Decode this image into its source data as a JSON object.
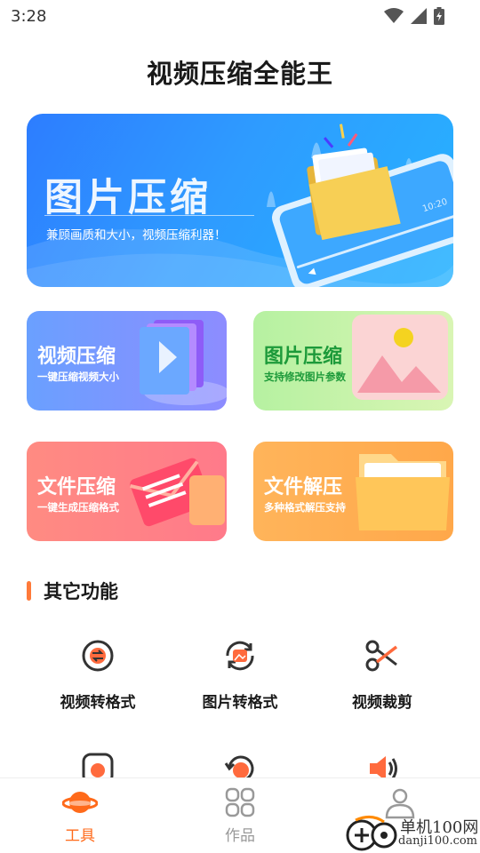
{
  "status": {
    "time": "3:28"
  },
  "app": {
    "title": "视频压缩全能王"
  },
  "banner": {
    "title": "图片压缩",
    "subtitle": "兼顾画质和大小，视频压缩利器！",
    "phone_time": "10:20"
  },
  "cards": [
    {
      "title": "视频压缩",
      "subtitle": "一键压缩视频大小"
    },
    {
      "title": "图片压缩",
      "subtitle": "支持修改图片参数"
    },
    {
      "title": "文件压缩",
      "subtitle": "一键生成压缩格式"
    },
    {
      "title": "文件解压",
      "subtitle": "多种格式解压支持"
    }
  ],
  "section": {
    "title": "其它功能"
  },
  "tools": [
    {
      "label": "视频转格式",
      "icon": "video-convert-icon"
    },
    {
      "label": "图片转格式",
      "icon": "image-convert-icon"
    },
    {
      "label": "视频裁剪",
      "icon": "scissors-icon"
    },
    {
      "label": "",
      "icon": "video-extract-icon"
    },
    {
      "label": "",
      "icon": "rotate-icon"
    },
    {
      "label": "",
      "icon": "audio-icon"
    }
  ],
  "tabs": [
    {
      "label": "工具",
      "icon": "planet-icon",
      "active": true
    },
    {
      "label": "作品",
      "icon": "grid-icon",
      "active": false
    },
    {
      "label": "",
      "icon": "profile-icon",
      "active": false
    }
  ],
  "watermark": {
    "line1": "单机100网",
    "line2": "danji100.com"
  },
  "colors": {
    "accent": "#ff6a1a",
    "banner_blue": "#2e9bff",
    "tool_orange": "#ff6a3d"
  }
}
